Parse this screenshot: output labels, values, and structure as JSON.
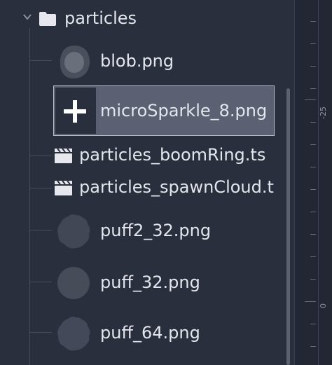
{
  "folder": {
    "label": "particles"
  },
  "files": [
    {
      "label": "blob.png",
      "icon": "blob-thumbnail-icon"
    },
    {
      "label": "microSparkle_8.png",
      "icon": "sparkle-thumbnail-icon",
      "selected": true
    },
    {
      "label": "particles_boomRing.ts",
      "icon": "clapperboard-icon"
    },
    {
      "label": "particles_spawnCloud.t",
      "icon": "clapperboard-icon"
    },
    {
      "label": "puff2_32.png",
      "icon": "puff-thumbnail-icon"
    },
    {
      "label": "puff_32.png",
      "icon": "puff-thumbnail-icon"
    },
    {
      "label": "puff_64.png",
      "icon": "puff-thumbnail-icon"
    }
  ],
  "ruler": {
    "labels": [
      "-25",
      "0"
    ]
  },
  "colors": {
    "selection_bg": "#5b6172",
    "panel_bg": "#2a2f3d",
    "text": "#e3e6ec"
  }
}
